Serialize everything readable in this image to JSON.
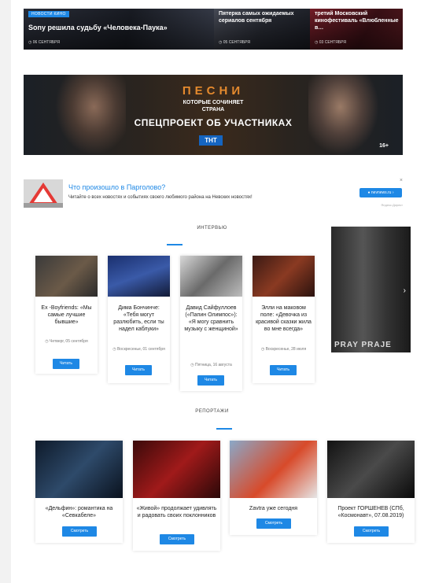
{
  "top_news": [
    {
      "badge": "НОВОСТИ КИНО",
      "title": "Sony решила судьбу «Человека-Паука»",
      "date": "06 СЕНТЯБРЯ"
    },
    {
      "title": "Пятерка самых ожидаемых сериалов сентября",
      "date": "05 СЕНТЯБРЯ"
    },
    {
      "title": "третий Московский кинофестиваль «Влюбленные в…",
      "date": "03 СЕНТЯБРЯ"
    }
  ],
  "banner": {
    "songs": "ПЕСНИ",
    "subtitle_line1": "КОТОРЫЕ СОЧИНЯЕТ",
    "subtitle_line2": "СТРАНА",
    "special": "СПЕЦПРОЕКТ ОБ УЧАСТНИКАХ",
    "channel": "ТНТ",
    "age_rating": "16+"
  },
  "ad": {
    "heading": "Что произошло в Парголово?",
    "text": "Читайте о всех новостях и событиях своего любимого района на Невских новостях!",
    "button": "nevnews.ru",
    "close": "×",
    "label": "Яндекс.Директ"
  },
  "interviews": {
    "heading": "ИНТЕРВЬЮ",
    "cards": [
      {
        "title": "Ex -Boyfriends: «Мы самые лучшие бывшие»",
        "date": "Четверг, 05 сентября",
        "button": "Читать"
      },
      {
        "title": "Дима Бончинче: «Тебя могут разлюбить, если ты надел каблуки»",
        "date": "Воскресенье, 01 сентября",
        "button": "Читать"
      },
      {
        "title": "Давид Сайфуллоев («Папин Олимпос»): «Я могу сравнить музыку с женщиной»",
        "date": "Пятница, 16 августа",
        "button": "Читать"
      },
      {
        "title": "Элли на маковом поле: «Девочка из красивой сказки жила во мне всегда»",
        "date": "Воскресенье, 28 июля",
        "button": "Читать"
      }
    ],
    "side_image_text": "PRAY PRAJE"
  },
  "reports": {
    "heading": "РЕПОРТАЖИ",
    "cards": [
      {
        "title": "«Дельфин»: романтика на «Севкабеле»",
        "button": "Смотреть"
      },
      {
        "title": "«Живой» продолжает удивлять и радовать своих поклонников",
        "button": "Смотреть"
      },
      {
        "title": "Zavtra уже сегодня",
        "button": "Смотреть"
      },
      {
        "title": "Проект ГОРШЕНЕВ (СПб, «Космонавт», 07.08.2019)",
        "button": "Смотреть"
      }
    ]
  },
  "colors": {
    "accent": "#1e88e5"
  }
}
